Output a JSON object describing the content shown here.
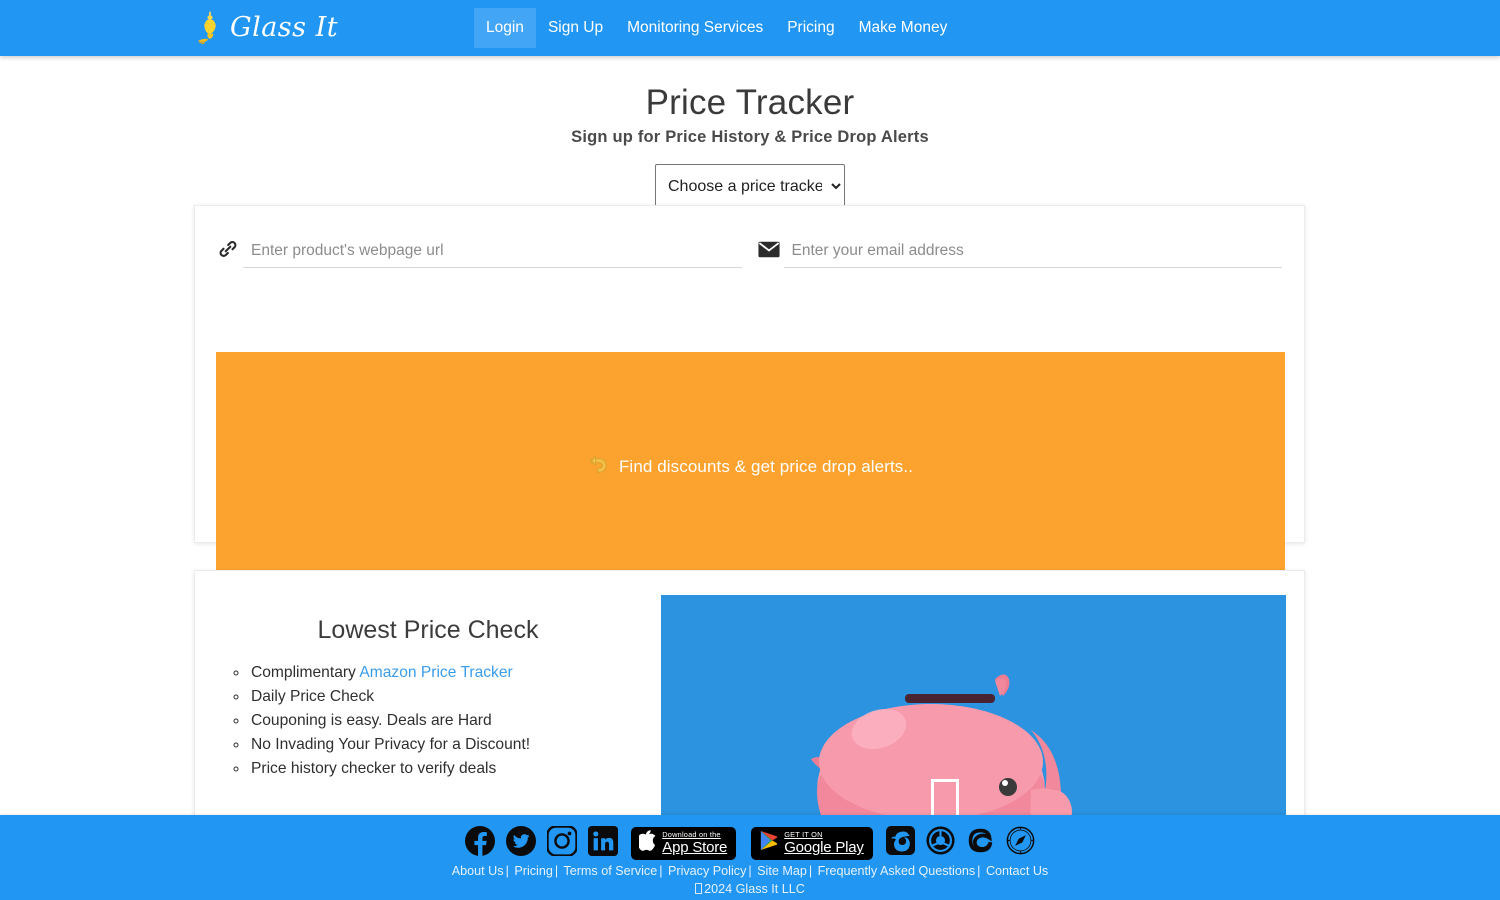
{
  "navbar": {
    "brand": {
      "name": "Glass It",
      "icon": "genie-lamp-icon"
    },
    "items": [
      {
        "label": "Login",
        "active": true
      },
      {
        "label": "Sign Up",
        "active": false
      },
      {
        "label": "Monitoring Services",
        "active": false
      },
      {
        "label": "Pricing",
        "active": false
      },
      {
        "label": "Make Money",
        "active": false
      }
    ]
  },
  "hero": {
    "title": "Price Tracker",
    "subtitle": "Sign up for Price History & Price Drop Alerts",
    "select": {
      "selected": "Choose a price tracker",
      "options": [
        "Choose a price tracker"
      ]
    }
  },
  "form": {
    "url_field": {
      "placeholder": "Enter product's webpage url",
      "value": "",
      "icon": "link-icon"
    },
    "email_field": {
      "placeholder": "Enter your email address",
      "value": "",
      "icon": "envelope-icon"
    },
    "banner": {
      "emoji": "⤵",
      "text": "Find discounts & get price drop alerts..",
      "background": "#fca22e"
    }
  },
  "info": {
    "heading": "Lowest Price Check",
    "bullets": [
      {
        "pre": "Complimentary ",
        "link": "Amazon Price Tracker",
        "post": ""
      },
      {
        "pre": "Daily Price Check",
        "link": "",
        "post": ""
      },
      {
        "pre": "Couponing is easy. Deals are Hard",
        "link": "",
        "post": ""
      },
      {
        "pre": "No Invading Your Privacy for a Discount!",
        "link": "",
        "post": ""
      },
      {
        "pre": "Price history checker to verify deals",
        "link": "",
        "post": ""
      }
    ],
    "image_alt": "piggy-bank-illustration",
    "image_background": "#2b93e0"
  },
  "footer": {
    "social": [
      {
        "name": "facebook-icon"
      },
      {
        "name": "twitter-icon"
      },
      {
        "name": "instagram-icon"
      },
      {
        "name": "linkedin-icon"
      }
    ],
    "appstore": {
      "small": "Download on the",
      "big": "App Store"
    },
    "googleplay": {
      "small": "GET IT ON",
      "big": "Google Play"
    },
    "browsers": [
      {
        "name": "firefox-icon"
      },
      {
        "name": "chrome-icon"
      },
      {
        "name": "edge-icon"
      },
      {
        "name": "safari-icon"
      }
    ],
    "links": [
      "About Us",
      "Pricing",
      "Terms of Service",
      "Privacy Policy",
      "Site Map",
      "Frequently Asked Questions",
      "Contact Us"
    ],
    "separator": "|",
    "copyright": "2024 Glass It LLC"
  },
  "colors": {
    "brand_blue": "#2196f3",
    "banner_orange": "#fca22e",
    "link_blue": "#3b9cea",
    "image_blue": "#2b93e0"
  }
}
